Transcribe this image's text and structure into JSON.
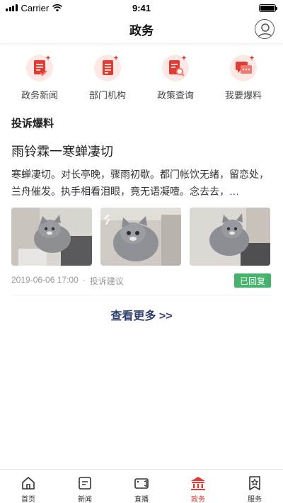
{
  "status_bar": {
    "carrier": "Carrier",
    "time": "9:41"
  },
  "header": {
    "title": "政务"
  },
  "quick_actions": [
    {
      "label": "政务新闻",
      "icon": "news-document-icon"
    },
    {
      "label": "部门机构",
      "icon": "department-document-icon"
    },
    {
      "label": "政策查询",
      "icon": "policy-search-icon"
    },
    {
      "label": "我要爆料",
      "icon": "report-message-icon"
    }
  ],
  "section": {
    "title": "投诉爆料"
  },
  "post": {
    "title": "雨铃霖一寒蝉凄切",
    "body": "寒蝉凄切。对长亭晚，骤雨初歇。都门帐饮无绪，留恋处，兰舟催发。执手相看泪眼，竟无语凝噎。念去去，…",
    "date": "2019-06-06 17:00",
    "separator": "·",
    "category": "投诉建议",
    "status": "已回复",
    "photos": [
      "cat-photo",
      "cat-photo",
      "cat-photo"
    ]
  },
  "more_link": "查看更多 >>",
  "tab_bar": [
    {
      "label": "首页",
      "icon": "home-icon",
      "active": false
    },
    {
      "label": "新闻",
      "icon": "news-icon",
      "active": false
    },
    {
      "label": "直播",
      "icon": "live-camera-icon",
      "active": false
    },
    {
      "label": "政务",
      "icon": "government-building-icon",
      "active": true
    },
    {
      "label": "服务",
      "icon": "service-star-icon",
      "active": false
    }
  ],
  "colors": {
    "accent_red": "#e23b33",
    "status_green": "#45b36b",
    "link_navy": "#2e3f6c"
  }
}
